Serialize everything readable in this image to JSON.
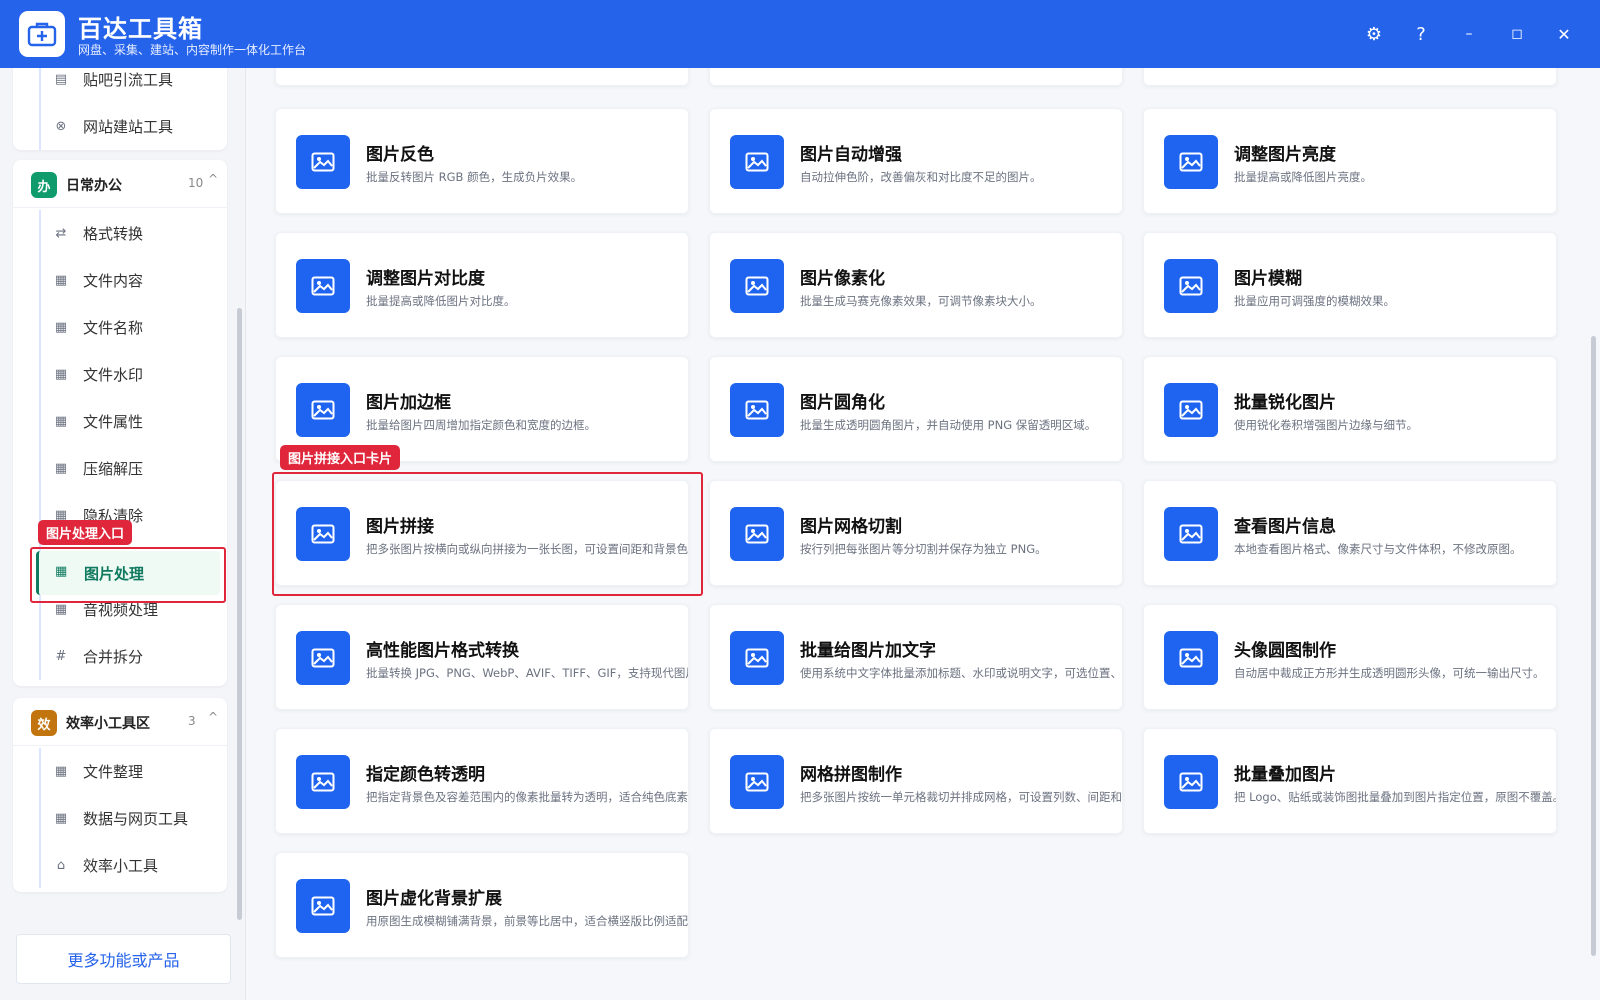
{
  "app": {
    "title": "百达工具箱",
    "subtitle": "网盘、采集、建站、内容制作一体化工作台"
  },
  "titlebar": {
    "settings": "⚙",
    "help": "?",
    "minimize": "–",
    "maximize": "◻",
    "close": "✕"
  },
  "sidebar": {
    "top_items": [
      {
        "label": "贴吧引流工具"
      },
      {
        "label": "网站建站工具"
      }
    ],
    "office": {
      "badge": "办",
      "title": "日常办公",
      "count": "10",
      "chevron": "^",
      "items": [
        {
          "label": "格式转换"
        },
        {
          "label": "文件内容"
        },
        {
          "label": "文件名称"
        },
        {
          "label": "文件水印"
        },
        {
          "label": "文件属性"
        },
        {
          "label": "压缩解压"
        },
        {
          "label": "隐私清除"
        },
        {
          "label": "图片处理"
        },
        {
          "label": "音视频处理"
        },
        {
          "label": "合并拆分"
        }
      ]
    },
    "efficiency": {
      "badge": "效",
      "title": "效率小工具区",
      "count": "3",
      "chevron": "^",
      "items": [
        {
          "label": "文件整理"
        },
        {
          "label": "数据与网页工具"
        },
        {
          "label": "效率小工具"
        }
      ]
    },
    "more": "更多功能或产品"
  },
  "annotations": {
    "sidebar_tag": "图片处理入口",
    "card_tag": "图片拼接入口卡片"
  },
  "cards": [
    {
      "title": "图片反色",
      "desc": "批量反转图片 RGB 颜色，生成负片效果。"
    },
    {
      "title": "图片自动增强",
      "desc": "自动拉伸色阶，改善偏灰和对比度不足的图片。"
    },
    {
      "title": "调整图片亮度",
      "desc": "批量提高或降低图片亮度。"
    },
    {
      "title": "调整图片对比度",
      "desc": "批量提高或降低图片对比度。"
    },
    {
      "title": "图片像素化",
      "desc": "批量生成马赛克像素效果，可调节像素块大小。"
    },
    {
      "title": "图片模糊",
      "desc": "批量应用可调强度的模糊效果。"
    },
    {
      "title": "图片加边框",
      "desc": "批量给图片四周增加指定颜色和宽度的边框。"
    },
    {
      "title": "图片圆角化",
      "desc": "批量生成透明圆角图片，并自动使用 PNG 保留透明区域。"
    },
    {
      "title": "批量锐化图片",
      "desc": "使用锐化卷积增强图片边缘与细节。"
    },
    {
      "title": "图片拼接",
      "desc": "把多张图片按横向或纵向拼接为一张长图，可设置间距和背景色。"
    },
    {
      "title": "图片网格切割",
      "desc": "按行列把每张图片等分切割并保存为独立 PNG。"
    },
    {
      "title": "查看图片信息",
      "desc": "本地查看图片格式、像素尺寸与文件体积，不修改原图。"
    },
    {
      "title": "高性能图片格式转换",
      "desc": "批量转换 JPG、PNG、WebP、AVIF、TIFF、GIF，支持现代图片格式。"
    },
    {
      "title": "批量给图片加文字",
      "desc": "使用系统中文字体批量添加标题、水印或说明文字，可选位置、字号。"
    },
    {
      "title": "头像圆图制作",
      "desc": "自动居中裁成正方形并生成透明圆形头像，可统一输出尺寸。"
    },
    {
      "title": "指定颜色转透明",
      "desc": "把指定背景色及容差范围内的像素批量转为透明，适合纯色底素材。"
    },
    {
      "title": "网格拼图制作",
      "desc": "把多张图片按统一单元格裁切并排成网格，可设置列数、间距和背景。"
    },
    {
      "title": "批量叠加图片",
      "desc": "把 Logo、贴纸或装饰图批量叠加到图片指定位置，原图不覆盖。"
    },
    {
      "title": "图片虚化背景扩展",
      "desc": "用原图生成模糊铺满背景，前景等比居中，适合横竖版比例适配。"
    }
  ]
}
